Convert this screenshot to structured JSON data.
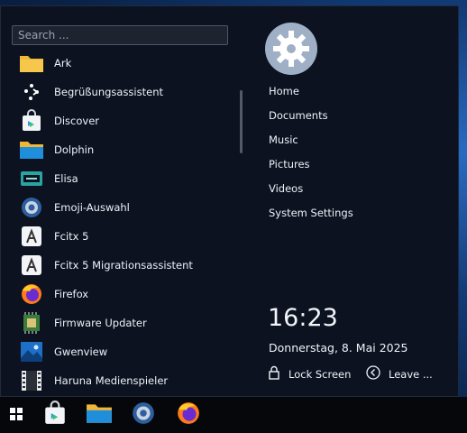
{
  "search": {
    "placeholder": "Search ..."
  },
  "apps": [
    {
      "label": "Ark",
      "icon": "ark-folder-icon"
    },
    {
      "label": "Begrüßungsassistent",
      "icon": "welcome-dots-icon"
    },
    {
      "label": "Discover",
      "icon": "discover-bag-icon"
    },
    {
      "label": "Dolphin",
      "icon": "dolphin-folder-icon"
    },
    {
      "label": "Elisa",
      "icon": "elisa-player-icon"
    },
    {
      "label": "Emoji-Auswahl",
      "icon": "emoji-picker-icon"
    },
    {
      "label": "Fcitx 5",
      "icon": "fcitx-icon"
    },
    {
      "label": "Fcitx 5 Migrationsassistent",
      "icon": "fcitx-migration-icon"
    },
    {
      "label": "Firefox",
      "icon": "firefox-icon"
    },
    {
      "label": "Firmware Updater",
      "icon": "firmware-chip-icon"
    },
    {
      "label": "Gwenview",
      "icon": "gwenview-image-icon"
    },
    {
      "label": "Haruna Medienspieler",
      "icon": "haruna-film-icon"
    }
  ],
  "places": [
    {
      "label": "Home"
    },
    {
      "label": "Documents"
    },
    {
      "label": "Music"
    },
    {
      "label": "Pictures"
    },
    {
      "label": "Videos"
    },
    {
      "label": "System Settings"
    }
  ],
  "clock": {
    "time": "16:23",
    "date": "Donnerstag, 8. Mai 2025"
  },
  "session": {
    "lock_label": "Lock Screen",
    "leave_label": "Leave ..."
  },
  "taskbar": {
    "pinned": [
      "discover-bag-icon",
      "dolphin-folder-icon",
      "system-settings-gear-icon",
      "firefox-icon"
    ]
  },
  "colors": {
    "menu_bg": "#0c1220",
    "taskbar_bg": "#05070b",
    "accent_blue": "#1f8fdc",
    "avatar_bg": "#9fb0c6"
  }
}
